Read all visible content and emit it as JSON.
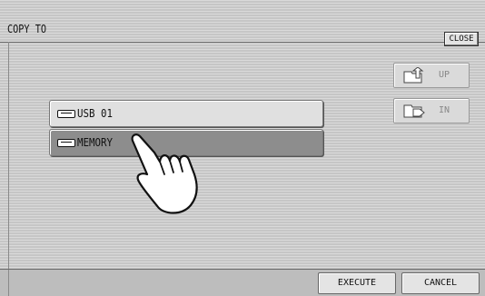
{
  "window": {
    "title": "COPY TO",
    "close_label": "CLOSE"
  },
  "devices": [
    {
      "label": "USB 01",
      "selected": false
    },
    {
      "label": "MEMORY",
      "selected": true
    }
  ],
  "navigation": {
    "up_label": "UP",
    "in_label": "IN",
    "up_enabled": false,
    "in_enabled": false
  },
  "actions": {
    "execute_label": "EXECUTE",
    "cancel_label": "CANCEL"
  },
  "icons": {
    "device": "drive-icon",
    "up": "folder-up-icon",
    "in": "folder-in-icon",
    "pointer": "pointing-hand-icon"
  }
}
